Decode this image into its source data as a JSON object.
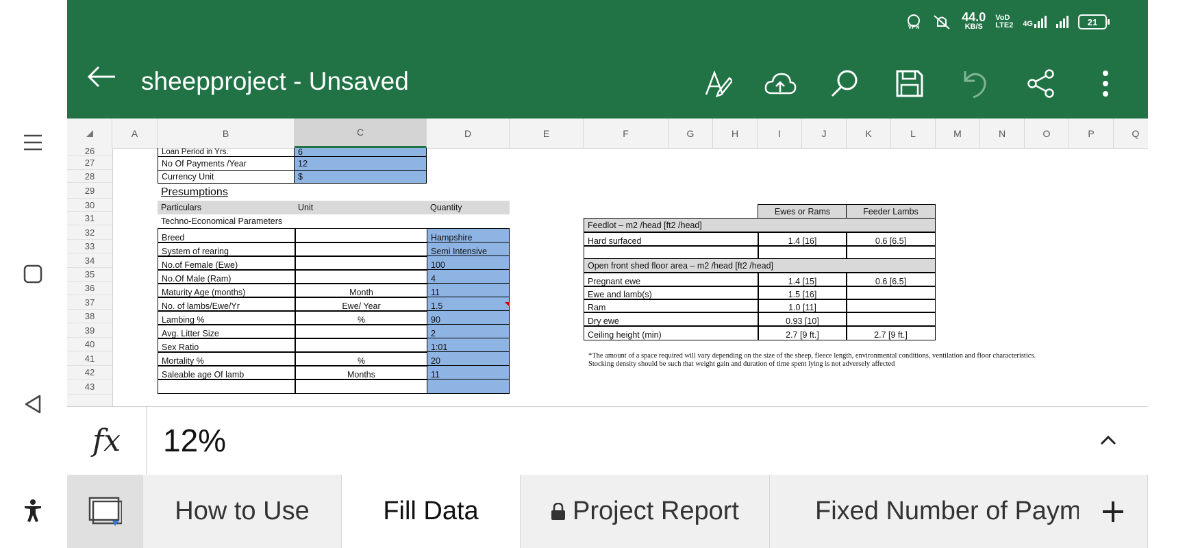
{
  "status_bar": {
    "speed_value": "44.0",
    "speed_unit": "KB/S",
    "network": "4G",
    "battery": "21"
  },
  "app": {
    "title": "sheepproject - Unsaved",
    "accent_color": "#217346"
  },
  "toolbar": {
    "icons": [
      "draw-icon",
      "cloud-upload-icon",
      "search-icon",
      "save-icon",
      "undo-icon",
      "share-icon",
      "more-icon"
    ]
  },
  "columns": [
    "A",
    "B",
    "C",
    "D",
    "E",
    "F",
    "G",
    "H",
    "I",
    "J",
    "K",
    "L",
    "M",
    "N",
    "O",
    "P",
    "Q"
  ],
  "rows": [
    "26",
    "27",
    "28",
    "29",
    "30",
    "31",
    "32",
    "33",
    "34",
    "35",
    "36",
    "37",
    "38",
    "39",
    "40",
    "41",
    "42",
    "43"
  ],
  "loan": [
    {
      "label": "Loan Period in Yrs.",
      "value": "6"
    },
    {
      "label": "No Of Payments /Year",
      "value": "12"
    },
    {
      "label": "Currency Unit",
      "value": "$"
    }
  ],
  "presumptions": {
    "heading": "Presumptions",
    "col_particulars": "Particulars",
    "col_unit": "Unit",
    "col_quantity": "Quantity",
    "section": "Techno-Economical Parameters",
    "rows": [
      {
        "particular": "Breed",
        "unit": "",
        "quantity": "Hampshire"
      },
      {
        "particular": "System of rearing",
        "unit": "",
        "quantity": "Semi Intensive"
      },
      {
        "particular": "No.of Female (Ewe)",
        "unit": "",
        "quantity": "100"
      },
      {
        "particular": "No.Of Male (Ram)",
        "unit": "",
        "quantity": "4"
      },
      {
        "particular": "Maturity Age (months)",
        "unit": "Month",
        "quantity": "11"
      },
      {
        "particular": "No. of lambs/Ewe/Yr",
        "unit": "Ewe/ Year",
        "quantity": "1.5"
      },
      {
        "particular": "Lambing %",
        "unit": "%",
        "quantity": "90"
      },
      {
        "particular": "Avg. Litter Size",
        "unit": "",
        "quantity": "2"
      },
      {
        "particular": "Sex Ratio",
        "unit": "",
        "quantity": "1:01"
      },
      {
        "particular": "Mortality %",
        "unit": "%",
        "quantity": "20"
      },
      {
        "particular": "Saleable age Of lamb",
        "unit": "Months",
        "quantity": "11"
      },
      {
        "particular": "",
        "unit": "",
        "quantity": ""
      }
    ]
  },
  "space": {
    "col_ewes": "Ewes or Rams",
    "col_feeder": "Feeder Lambs",
    "feedlot_header": "Feedlot – m2 /head [ft2 /head]",
    "hard_surfaced": {
      "label": "Hard surfaced",
      "ewes": "1.4 [16]",
      "feeder": "0.6 [6.5]"
    },
    "shed_header": "Open front shed floor area – m2 /head [ft2 /head]",
    "shed_rows": [
      {
        "label": "Pregnant ewe",
        "ewes": "1.4 [15]",
        "feeder": "0.6 [6.5]"
      },
      {
        "label": "Ewe and lamb(s)",
        "ewes": "1.5 [16]",
        "feeder": ""
      },
      {
        "label": "Ram",
        "ewes": "1.0 [11]",
        "feeder": ""
      },
      {
        "label": "Dry ewe",
        "ewes": "0.93 [10]",
        "feeder": ""
      },
      {
        "label": "Ceiling height (min)",
        "ewes": "2.7 [9 ft.]",
        "feeder": "2.7 [9 ft.]"
      }
    ],
    "note_line1": "*The amount of a space required will vary depending on the size of the sheep, fleece length, environmental conditions, ventilation and floor characteristics.",
    "note_line2": "Stocking density should be such that weight gain and duration of time spent lying is not adversely affected"
  },
  "formula_bar": {
    "fx": "fx",
    "value": "12%"
  },
  "sheet_tabs": {
    "tab1": "How to Use",
    "tab2": "Fill Data",
    "tab3": "Project Report",
    "tab4": "Fixed Number of Payme"
  }
}
